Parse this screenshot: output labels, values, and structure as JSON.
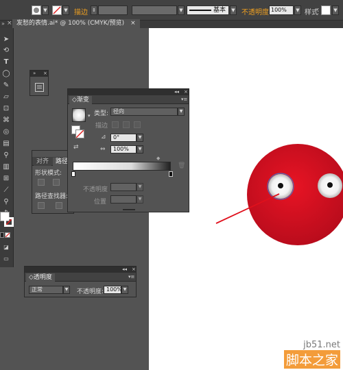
{
  "control_bar": {
    "stroke_label": "描边",
    "stroke_profile_label": "基本",
    "opacity_label": "不透明度",
    "opacity_value": "100%",
    "style_label": "样式"
  },
  "document_tab": {
    "title": "发愁的表情.ai* @ 100% (CMYK/预览)",
    "close": "×"
  },
  "gradient_panel": {
    "tab_label": "渐变",
    "type_label": "类型:",
    "type_value": "径向",
    "stroke_label": "描边",
    "angle_value": "0°",
    "aspect_value": "100%",
    "opacity_label": "不透明度",
    "location_label": "位置"
  },
  "align_panel": {
    "tab_align": "对齐",
    "tab_pathfinder": "路径",
    "shape_modes_label": "形状模式:",
    "pathfinders_label": "路径查找器:"
  },
  "transparency_panel": {
    "tab_label": "透明度",
    "blend_mode": "正常",
    "opacity_label": "不透明度:",
    "opacity_value": "100%"
  },
  "artwork": {
    "face_color": "#d11020",
    "line_color": "#e0101c"
  },
  "watermark": {
    "site": "jb51.net",
    "name": "脚本之家"
  },
  "colors": {
    "accent_orange": "#f0a020",
    "panel_bg": "#535353",
    "bar_bg": "#424242"
  }
}
